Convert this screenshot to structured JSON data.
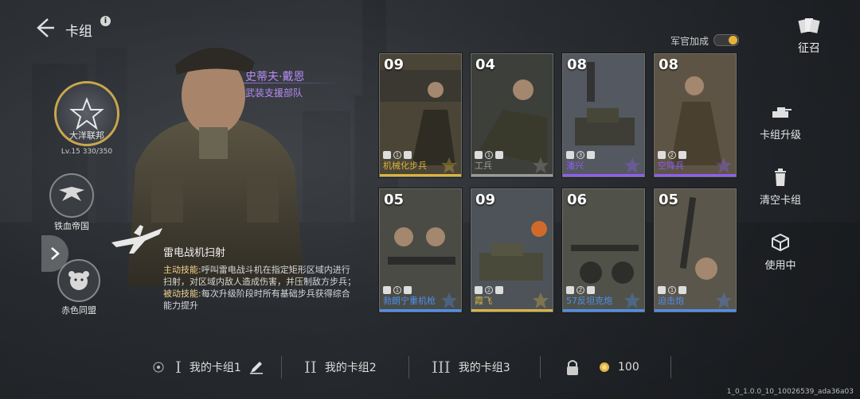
{
  "header": {
    "title": "卡组",
    "info_glyph": "i"
  },
  "recruit": {
    "label": "征召"
  },
  "officer_bonus": {
    "label": "军官加成",
    "enabled": true
  },
  "factions": [
    {
      "name": "大洋联邦",
      "level": "Lv.15",
      "exp": "330/350",
      "selected": true
    },
    {
      "name": "铁血帝国",
      "selected": false
    },
    {
      "name": "赤色同盟",
      "selected": false
    }
  ],
  "general": {
    "name": "史蒂夫·戴恩",
    "unit": "武装支援部队"
  },
  "skill": {
    "title": "雷电战机扫射",
    "active_label": "主动技能:",
    "active_text": "呼叫雷电战斗机在指定矩形区域内进行扫射，对区域内敌人造成伤害，并压制敌方步兵；",
    "passive_label": "被动技能:",
    "passive_text": "每次升级阶段时所有基础步兵获得综合能力提升"
  },
  "cards": [
    {
      "cost": "09",
      "name": "机械化步兵",
      "count": "1",
      "rarity_color": "#d9b441"
    },
    {
      "cost": "04",
      "name": "工兵",
      "count": "1",
      "rarity_color": "#9a9a9a"
    },
    {
      "cost": "08",
      "name": "潘兴",
      "count": "3",
      "rarity_color": "#8e5ef0"
    },
    {
      "cost": "08",
      "name": "空降兵",
      "count": "2",
      "rarity_color": "#8e5ef0"
    },
    {
      "cost": "05",
      "name": "勃朗宁重机枪",
      "count": "1",
      "rarity_color": "#4d8ff0"
    },
    {
      "cost": "09",
      "name": "霞飞",
      "count": "2",
      "rarity_color": "#d9b441"
    },
    {
      "cost": "06",
      "name": "57反坦克炮",
      "count": "2",
      "rarity_color": "#4d8ff0"
    },
    {
      "cost": "05",
      "name": "迫击炮",
      "count": "1",
      "rarity_color": "#4d8ff0"
    }
  ],
  "actions": {
    "upgrade": "卡组升级",
    "clear": "清空卡组",
    "in_use": "使用中"
  },
  "decks": [
    {
      "roman": "I",
      "label": "我的卡组1"
    },
    {
      "roman": "II",
      "label": "我的卡组2"
    },
    {
      "roman": "III",
      "label": "我的卡组3"
    }
  ],
  "locked_deck": {
    "price": "100"
  },
  "version": "1_0_1.0.0_10_10026539_ada36a03"
}
